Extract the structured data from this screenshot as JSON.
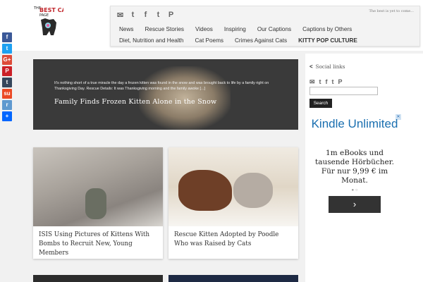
{
  "header": {
    "logo_text": "THE BEST CAT PAGE",
    "tagline": "The best is yet to come...",
    "social_icons": [
      "envelope-icon",
      "twitter-icon",
      "facebook-icon",
      "tumblr-icon",
      "pinterest-icon"
    ],
    "menu_row1": [
      "News",
      "Rescue Stories",
      "Videos",
      "Inspiring",
      "Our Captions",
      "Captions by Others"
    ],
    "menu_row2": [
      "Diet, Nutrition and Health",
      "Cat Poems",
      "Crimes Against Cats",
      "KITTY POP CULTURE"
    ]
  },
  "share_bar": [
    {
      "name": "facebook",
      "glyph": "f",
      "color": "#3b5998"
    },
    {
      "name": "twitter",
      "glyph": "t",
      "color": "#1da1f2"
    },
    {
      "name": "google-plus",
      "glyph": "G+",
      "color": "#dd4b39"
    },
    {
      "name": "pinterest",
      "glyph": "P",
      "color": "#cb2027"
    },
    {
      "name": "tumblr",
      "glyph": "t",
      "color": "#35465c"
    },
    {
      "name": "stumbleupon",
      "glyph": "su",
      "color": "#eb4924"
    },
    {
      "name": "reddit",
      "glyph": "r",
      "color": "#5f99cf"
    },
    {
      "name": "share",
      "glyph": "+",
      "color": "#0166ff"
    }
  ],
  "featured": {
    "excerpt": "It's nothing short of a true miracle the day a frozen kitten was found in the snow and was brought back to life by a family right on Thanksgiving Day. Rescue Details: It was Thanksgiving morning and the family awoke [...]",
    "title": "Family Finds Frozen Kitten Alone in the Snow"
  },
  "cards": [
    {
      "title": "ISIS Using Pictures of Kittens With Bombs to Recruit New, Young Members"
    },
    {
      "title": "Rescue Kitten Adopted by Poodle Who was Raised by Cats"
    }
  ],
  "sidebar": {
    "social_heading": "Social links",
    "social_icons": [
      "envelope-icon",
      "twitter-icon",
      "facebook-icon",
      "tumblr-icon",
      "pinterest-icon"
    ],
    "search_value": "",
    "search_button": "Search"
  },
  "ad": {
    "brand": "Kindle Unlimited",
    "body": "1m eBooks und tausende Hörbücher. Für nur 9,99 € im Monat.",
    "dots": "● ○",
    "arrow": "›",
    "close": "✕"
  },
  "colors": {
    "featured_bg": "#3a3a3a",
    "ad_brand": "#1a6fb0",
    "search_button_bg": "#222222"
  }
}
